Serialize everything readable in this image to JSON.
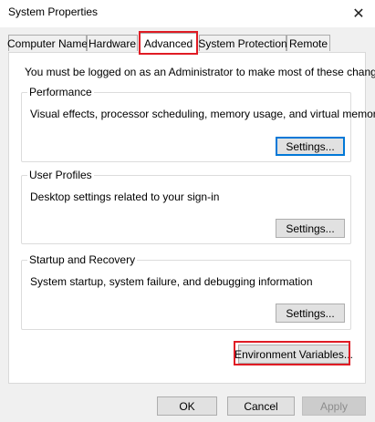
{
  "window": {
    "title": "System Properties",
    "close_glyph": "✕"
  },
  "tabs": [
    {
      "label": "Computer Name"
    },
    {
      "label": "Hardware"
    },
    {
      "label": "Advanced",
      "selected": true
    },
    {
      "label": "System Protection"
    },
    {
      "label": "Remote"
    }
  ],
  "notice": "You must be logged on as an Administrator to make most of these changes.",
  "groups": {
    "performance": {
      "title": "Performance",
      "description": "Visual effects, processor scheduling, memory usage, and virtual memory",
      "button": "Settings..."
    },
    "user_profiles": {
      "title": "User Profiles",
      "description": "Desktop settings related to your sign-in",
      "button": "Settings..."
    },
    "startup_recovery": {
      "title": "Startup and Recovery",
      "description": "System startup, system failure, and debugging information",
      "button": "Settings..."
    }
  },
  "env_button": "Environment Variables...",
  "footer": {
    "ok": "OK",
    "cancel": "Cancel",
    "apply": "Apply"
  },
  "colors": {
    "highlight": "#e01b24",
    "focus": "#0078d7"
  }
}
